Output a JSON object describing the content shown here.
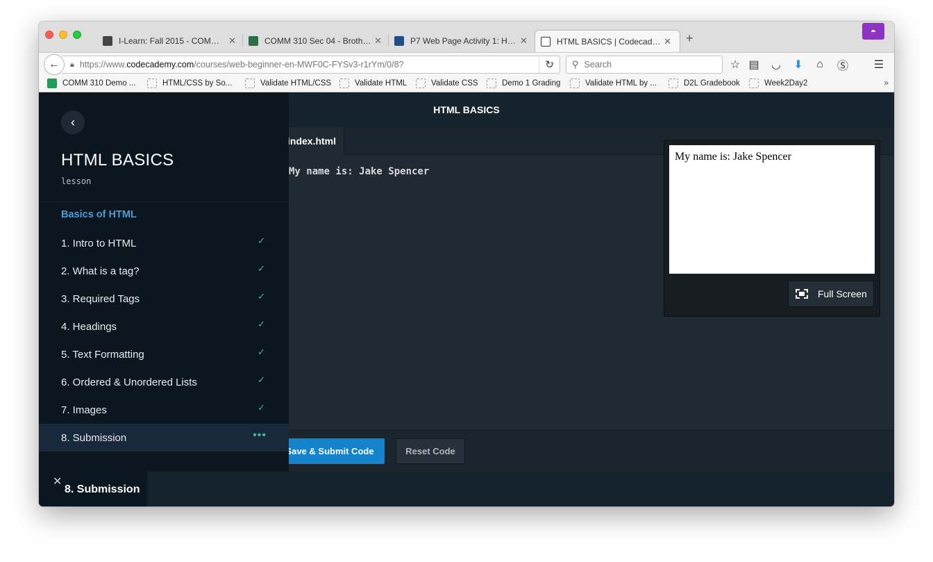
{
  "browser": {
    "tabs": [
      {
        "title": "I-Learn: Fall 2015 - COMM ..."
      },
      {
        "title": "COMM 310 Sec 04 - Brothe..."
      },
      {
        "title": "P7 Web Page Activity 1: HT..."
      },
      {
        "title": "HTML BASICS | Codecademy"
      }
    ],
    "new_tab_label": "+",
    "url": {
      "prefix": "https://www.",
      "domain": "codecademy.com",
      "path": "/courses/web-beginner-en-MWF0C-FYSv3-r1rYm/0/8?"
    },
    "search_placeholder": "Search",
    "bookmarks": [
      {
        "label": "COMM 310 Demo ..."
      },
      {
        "label": "HTML/CSS by So..."
      },
      {
        "label": "Validate HTML/CSS"
      },
      {
        "label": "Validate HTML"
      },
      {
        "label": "Validate CSS"
      },
      {
        "label": "Demo 1 Grading"
      },
      {
        "label": "Validate HTML by ..."
      },
      {
        "label": "D2L Gradebook"
      },
      {
        "label": "Week2Day2"
      }
    ],
    "bookmarks_more": "»"
  },
  "header": {
    "title": "HTML BASICS"
  },
  "editor": {
    "file_tab": "index.html",
    "code_line": "My name is: Jake Spencer"
  },
  "preview": {
    "content": "My name is: Jake Spencer",
    "fullscreen_label": "Full Screen"
  },
  "actions": {
    "save_label": "Save & Submit Code",
    "reset_label": "Reset Code"
  },
  "sidebar": {
    "title": "HTML BASICS",
    "subtitle": "lesson",
    "section": "Basics of HTML",
    "items": [
      {
        "label": "1. Intro to HTML",
        "status": "✓"
      },
      {
        "label": "2. What is a tag?",
        "status": "✓"
      },
      {
        "label": "3. Required Tags",
        "status": "✓"
      },
      {
        "label": "4. Headings",
        "status": "✓"
      },
      {
        "label": "5. Text Formatting",
        "status": "✓"
      },
      {
        "label": "6. Ordered & Unordered Lists",
        "status": "✓"
      },
      {
        "label": "7. Images",
        "status": "✓"
      },
      {
        "label": "8. Submission",
        "status": "•••"
      }
    ]
  },
  "bottom": {
    "current_lesson": "8. Submission"
  },
  "colors": {
    "accent_blue": "#1583cc",
    "check_teal": "#3fb8a8",
    "section_blue": "#4b9dd6"
  }
}
